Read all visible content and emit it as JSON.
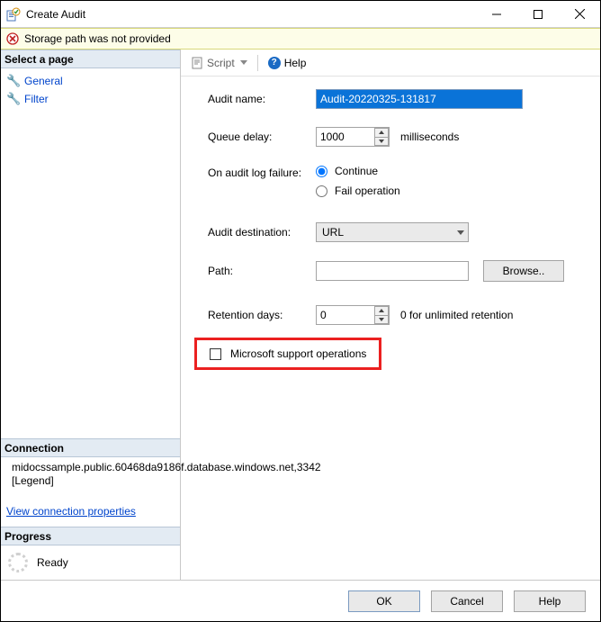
{
  "window": {
    "title": "Create Audit"
  },
  "error": {
    "message": "Storage path was not provided"
  },
  "left": {
    "select_page_header": "Select a page",
    "pages": {
      "general": "General",
      "filter": "Filter"
    },
    "connection_header": "Connection",
    "connection_text": "midocssample.public.60468da9186f.database.windows.net,3342\n[Legend]",
    "view_conn_link": "View connection properties",
    "progress_header": "Progress",
    "progress_status": "Ready"
  },
  "toolbar": {
    "script": "Script",
    "help": "Help"
  },
  "form": {
    "audit_name_label": "Audit name:",
    "audit_name_value": "Audit-20220325-131817",
    "queue_delay_label": "Queue delay:",
    "queue_delay_value": "1000",
    "queue_delay_suffix": "milliseconds",
    "on_failure_label": "On audit log failure:",
    "radio_continue": "Continue",
    "radio_fail": "Fail operation",
    "audit_dest_label": "Audit destination:",
    "audit_dest_value": "URL",
    "path_label": "Path:",
    "browse_btn": "Browse..",
    "retention_label": "Retention days:",
    "retention_value": "0",
    "retention_suffix": "0 for unlimited retention",
    "ms_support_label": "Microsoft support operations"
  },
  "footer": {
    "ok": "OK",
    "cancel": "Cancel",
    "help": "Help"
  }
}
